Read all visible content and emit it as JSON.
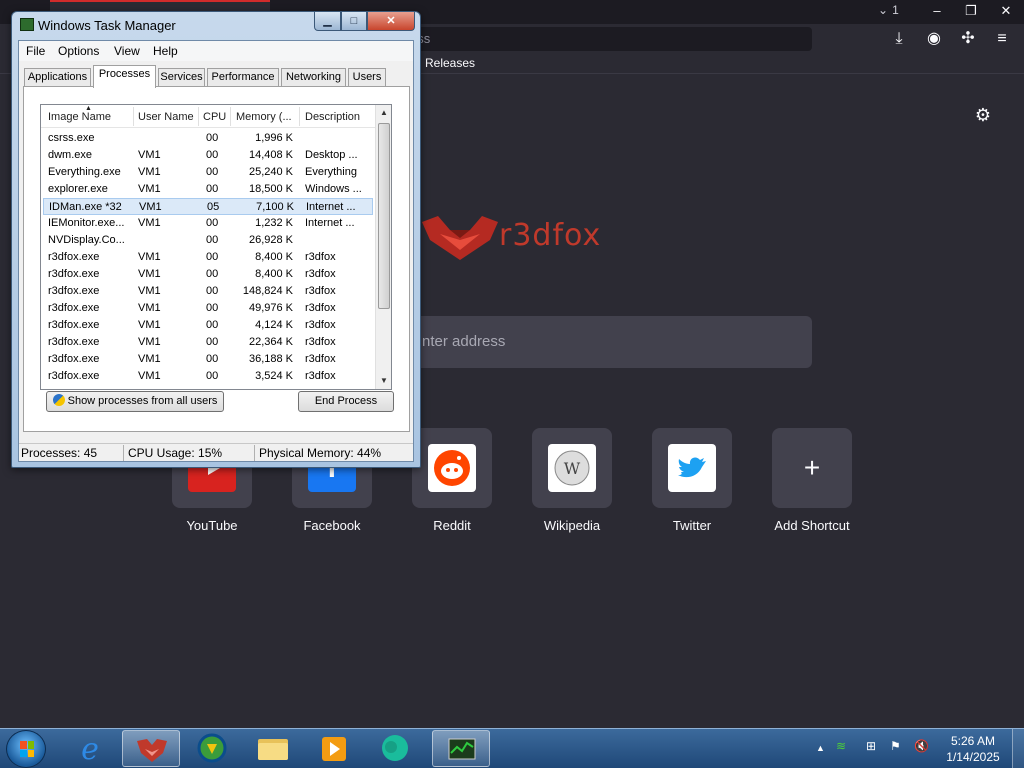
{
  "browser": {
    "tab_count": "1",
    "address_partial": "ess",
    "bookmark_item": "Releases",
    "logo_text": "r3dfox",
    "search_placeholder": "nter address",
    "shortcuts": [
      {
        "label": "YouTube",
        "icon": "youtube-icon"
      },
      {
        "label": "Facebook",
        "icon": "facebook-icon"
      },
      {
        "label": "Reddit",
        "icon": "reddit-icon"
      },
      {
        "label": "Wikipedia",
        "icon": "wikipedia-icon"
      },
      {
        "label": "Twitter",
        "icon": "twitter-icon"
      },
      {
        "label": "Add Shortcut",
        "icon": "plus-icon"
      }
    ],
    "accent": "#d12b2b"
  },
  "taskmanager": {
    "title": "Windows Task Manager",
    "menu": [
      "File",
      "Options",
      "View",
      "Help"
    ],
    "tabs": [
      "Applications",
      "Processes",
      "Services",
      "Performance",
      "Networking",
      "Users"
    ],
    "active_tab": "Processes",
    "columns": [
      "Image Name",
      "User Name",
      "CPU",
      "Memory (...",
      "Description"
    ],
    "rows": [
      [
        "csrss.exe",
        "",
        "00",
        "1,996 K",
        ""
      ],
      [
        "dwm.exe",
        "VM1",
        "00",
        "14,408 K",
        "Desktop ..."
      ],
      [
        "Everything.exe",
        "VM1",
        "00",
        "25,240 K",
        "Everything"
      ],
      [
        "explorer.exe",
        "VM1",
        "00",
        "18,500 K",
        "Windows ..."
      ],
      [
        "IDMan.exe *32",
        "VM1",
        "05",
        "7,100 K",
        "Internet ..."
      ],
      [
        "IEMonitor.exe...",
        "VM1",
        "00",
        "1,232 K",
        "Internet ..."
      ],
      [
        "NVDisplay.Co...",
        "",
        "00",
        "26,928 K",
        ""
      ],
      [
        "r3dfox.exe",
        "VM1",
        "00",
        "8,400 K",
        "r3dfox"
      ],
      [
        "r3dfox.exe",
        "VM1",
        "00",
        "8,400 K",
        "r3dfox"
      ],
      [
        "r3dfox.exe",
        "VM1",
        "00",
        "148,824 K",
        "r3dfox"
      ],
      [
        "r3dfox.exe",
        "VM1",
        "00",
        "49,976 K",
        "r3dfox"
      ],
      [
        "r3dfox.exe",
        "VM1",
        "00",
        "4,124 K",
        "r3dfox"
      ],
      [
        "r3dfox.exe",
        "VM1",
        "00",
        "22,364 K",
        "r3dfox"
      ],
      [
        "r3dfox.exe",
        "VM1",
        "00",
        "36,188 K",
        "r3dfox"
      ],
      [
        "r3dfox.exe",
        "VM1",
        "00",
        "3,524 K",
        "r3dfox"
      ]
    ],
    "selected_row": 4,
    "show_all_button": "Show processes from all users",
    "end_process_button": "End Process",
    "status": {
      "processes": "Processes: 45",
      "cpu": "CPU Usage: 15%",
      "memory": "Physical Memory: 44%"
    }
  },
  "taskbar": {
    "time": "5:26 AM",
    "date": "1/14/2025"
  }
}
